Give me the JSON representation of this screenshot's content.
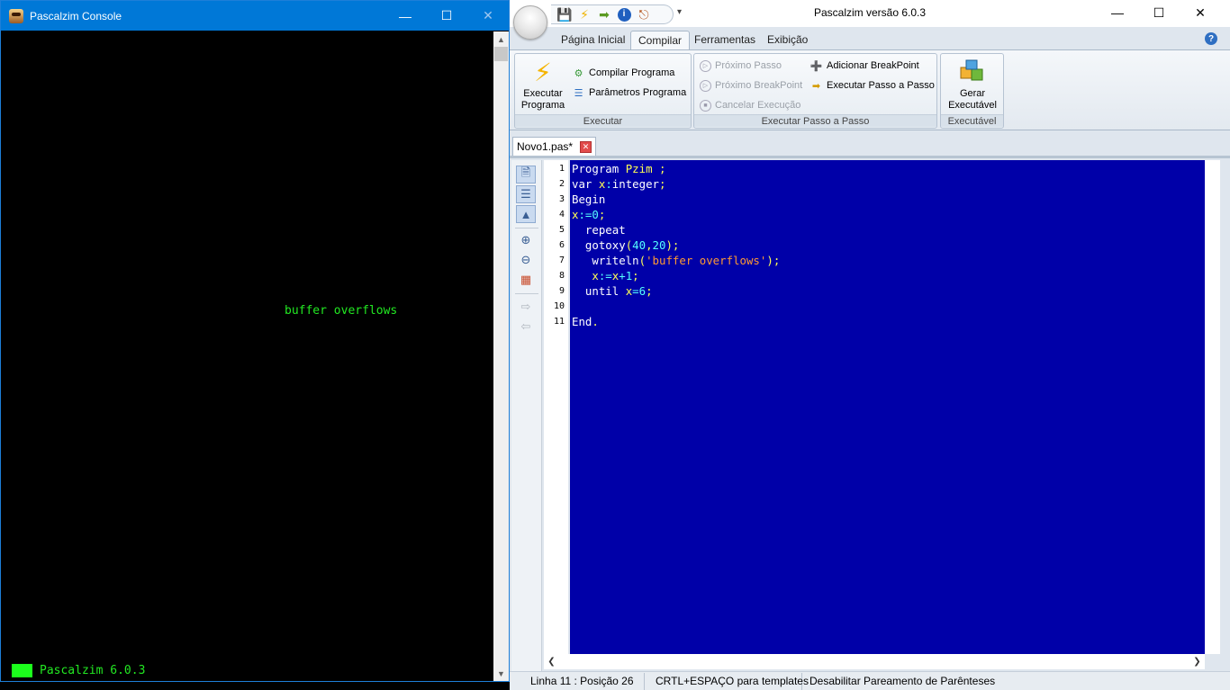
{
  "console": {
    "title": "Pascalzim Console",
    "output_line": "buffer overflows",
    "status_text": "Pascalzim 6.0.3",
    "status_block_color": "#1cff1c"
  },
  "ide": {
    "title": "Pascalzim versão 6.0.3",
    "quick_access": [
      "save-icon",
      "lightning-icon",
      "step-icon",
      "info-icon",
      "exit-icon"
    ],
    "tabs": [
      "Página Inicial",
      "Compilar",
      "Ferramentas",
      "Exibição"
    ],
    "active_tab": "Compilar",
    "ribbon": {
      "executar": {
        "label": "Executar",
        "big_button": {
          "line1": "Executar",
          "line2": "Programa"
        },
        "compilar": "Compilar Programa",
        "parametros": "Parâmetros Programa"
      },
      "passo": {
        "label": "Executar Passo a Passo",
        "proximo_passo": "Próximo Passo",
        "proximo_breakpoint": "Próximo BreakPoint",
        "cancelar": "Cancelar Execução",
        "adicionar_breakpoint": "Adicionar BreakPoint",
        "executar_passo": "Executar Passo a Passo"
      },
      "executavel": {
        "label": "Executável",
        "big_button": {
          "line1": "Gerar",
          "line2": "Executável"
        }
      }
    },
    "document_tab": "Novo1.pas*",
    "line_numbers": [
      "1",
      "2",
      "3",
      "4",
      "5",
      "6",
      "7",
      "8",
      "9",
      "10",
      "11"
    ],
    "code_lines": [
      [
        {
          "t": "Program ",
          "c": "kw"
        },
        {
          "t": "Pzim",
          "c": "id"
        },
        {
          "t": " ;",
          "c": "id"
        }
      ],
      [
        {
          "t": "var ",
          "c": "kw"
        },
        {
          "t": "x",
          "c": "id"
        },
        {
          "t": ":",
          "c": "sym"
        },
        {
          "t": "integer",
          "c": "kw"
        },
        {
          "t": ";",
          "c": "id"
        }
      ],
      [
        {
          "t": "Begin",
          "c": "kw"
        }
      ],
      [
        {
          "t": "x",
          "c": "id"
        },
        {
          "t": ":=",
          "c": "sym"
        },
        {
          "t": "0",
          "c": "num"
        },
        {
          "t": ";",
          "c": "id"
        }
      ],
      [
        {
          "t": "  repeat",
          "c": "kw"
        }
      ],
      [
        {
          "t": "  gotoxy",
          "c": "kw"
        },
        {
          "t": "(",
          "c": "id"
        },
        {
          "t": "40",
          "c": "num"
        },
        {
          "t": ",",
          "c": "id"
        },
        {
          "t": "20",
          "c": "num"
        },
        {
          "t": ");",
          "c": "id"
        }
      ],
      [
        {
          "t": "   writeln",
          "c": "kw"
        },
        {
          "t": "(",
          "c": "id"
        },
        {
          "t": "'buffer overflows'",
          "c": "str"
        },
        {
          "t": ");",
          "c": "id"
        }
      ],
      [
        {
          "t": "   x",
          "c": "id"
        },
        {
          "t": ":=",
          "c": "sym"
        },
        {
          "t": "x",
          "c": "id"
        },
        {
          "t": "+",
          "c": "sym"
        },
        {
          "t": "1",
          "c": "num"
        },
        {
          "t": ";",
          "c": "id"
        }
      ],
      [
        {
          "t": "  until ",
          "c": "kw"
        },
        {
          "t": "x",
          "c": "id"
        },
        {
          "t": "=",
          "c": "sym"
        },
        {
          "t": "6",
          "c": "num"
        },
        {
          "t": ";",
          "c": "id"
        }
      ],
      [],
      [
        {
          "t": "End",
          "c": "kw"
        },
        {
          "t": ".",
          "c": "id"
        }
      ]
    ],
    "status": {
      "position": "Linha 11 : Posição 26",
      "templates": "CRTL+ESPAÇO para templates",
      "parenteses": "Desabilitar Pareamento de Parênteses"
    },
    "colors": {
      "editor_bg": "#0000a8",
      "keyword": "#ffffff",
      "identifier": "#ffff55",
      "number": "#55ffff",
      "string": "#ff9a33"
    }
  }
}
